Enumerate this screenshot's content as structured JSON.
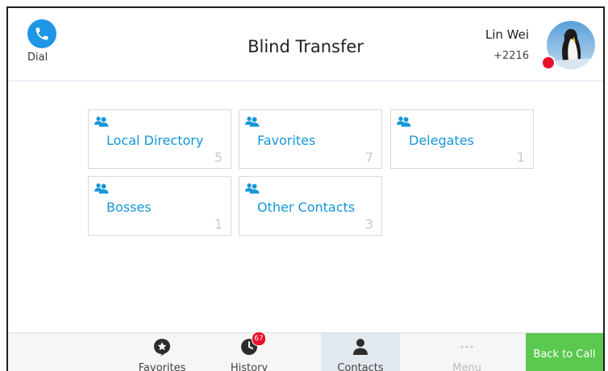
{
  "header": {
    "title": "Blind Transfer",
    "dial_label": "Dial",
    "user_name": "Lin Wei",
    "user_ext": "+2216"
  },
  "contacts": {
    "items": [
      {
        "label": "Local Directory",
        "count": "5"
      },
      {
        "label": "Favorites",
        "count": "7"
      },
      {
        "label": "Delegates",
        "count": "1"
      },
      {
        "label": "Bosses",
        "count": "1"
      },
      {
        "label": "Other Contacts",
        "count": "3"
      }
    ]
  },
  "bottom_bar": {
    "tabs": [
      {
        "label": "Favorites",
        "icon": "favorites-star-icon"
      },
      {
        "label": "History",
        "icon": "history-clock-icon",
        "badge": "67"
      },
      {
        "label": "Contacts",
        "icon": "person-icon",
        "active": true
      },
      {
        "label": "Menu",
        "icon": "dots-icon",
        "disabled": true
      }
    ],
    "back_to_call": "Back to Call"
  },
  "colors": {
    "accent": "#1596d8",
    "dial": "#1e96e5",
    "back_to_call": "#5bc84f",
    "badge": "#e8102a",
    "presence_busy": "#e8102a"
  }
}
